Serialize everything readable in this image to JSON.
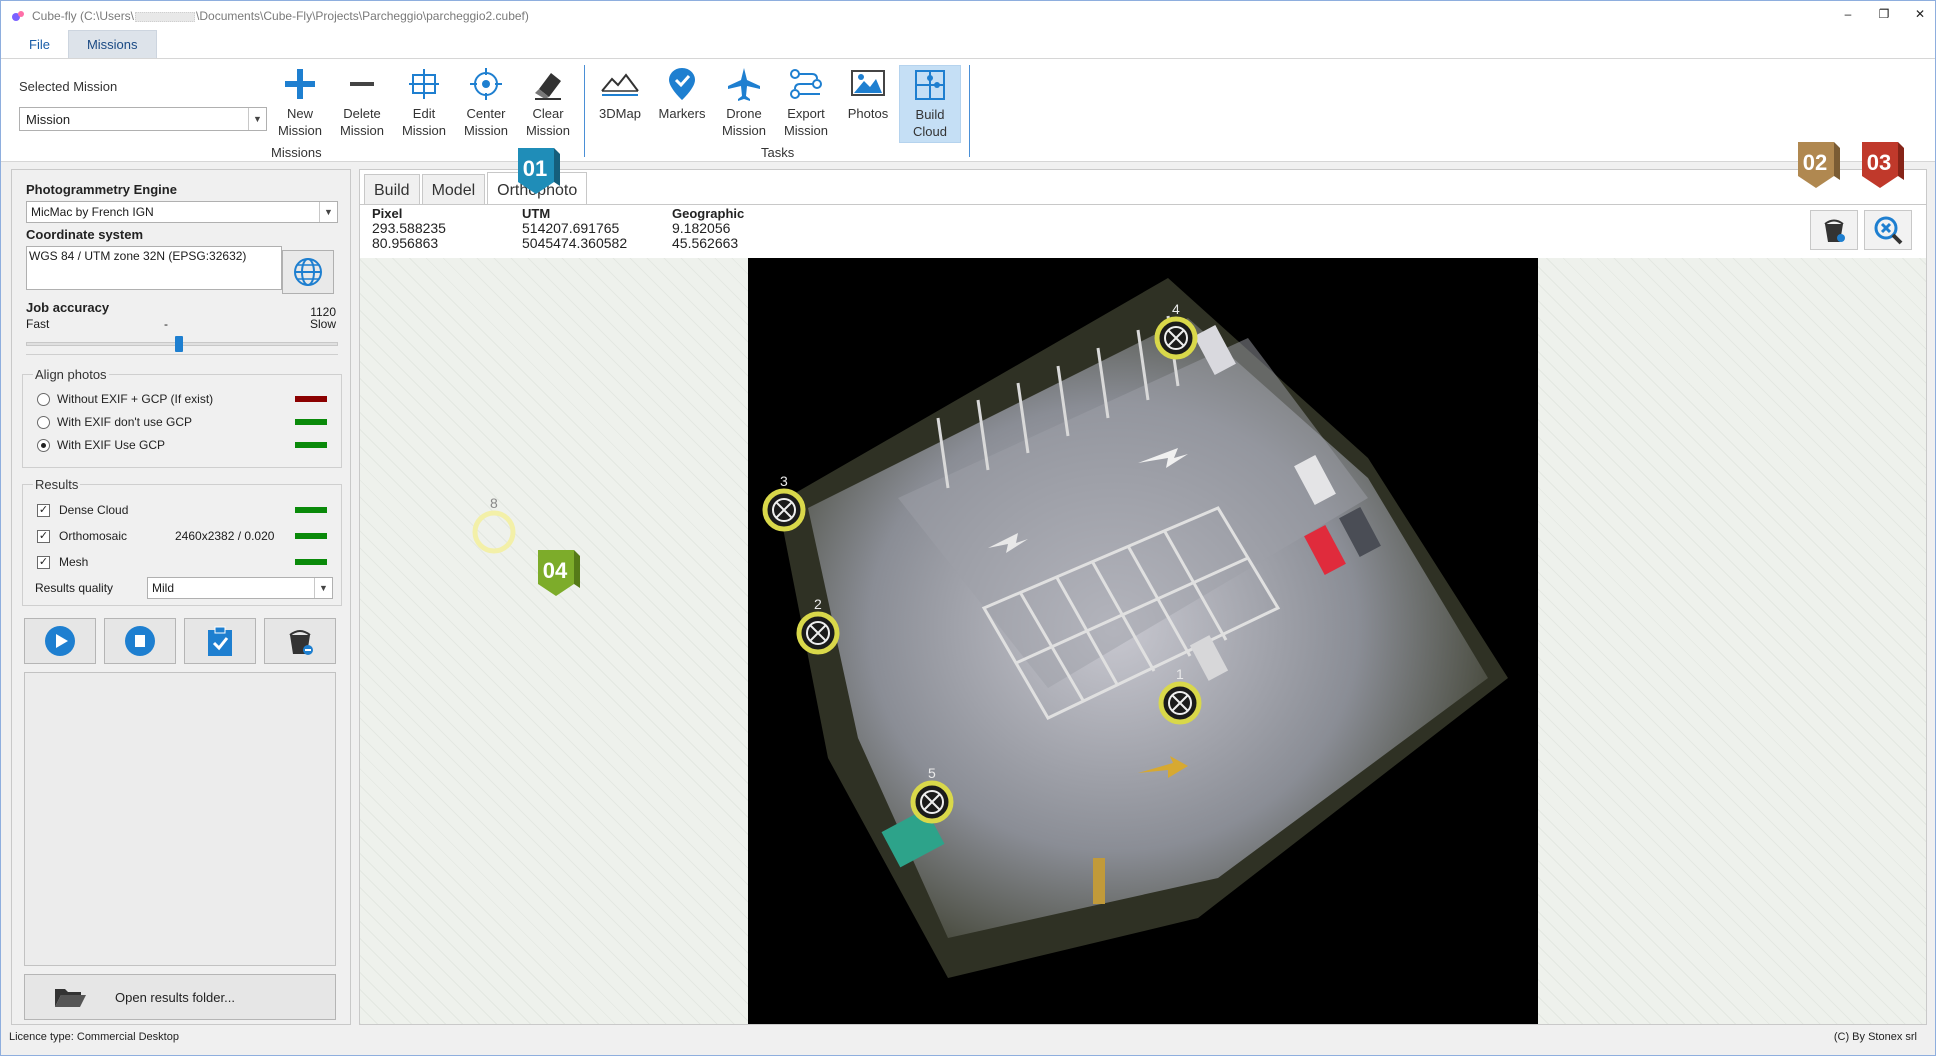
{
  "window": {
    "title_prefix": "Cube-fly (C:\\Users\\",
    "title_suffix": "\\Documents\\Cube-Fly\\Projects\\Parcheggio\\parcheggio2.cubef)",
    "controls": [
      "–",
      "❐",
      "✕"
    ]
  },
  "menu": {
    "tabs": [
      "File",
      "Missions"
    ],
    "active": "Missions"
  },
  "ribbon": {
    "selected_mission_label": "Selected Mission",
    "selected_mission_value": "Mission",
    "missions_group": "Missions",
    "tasks_group": "Tasks",
    "buttons": {
      "new_mission": "New Mission",
      "delete_mission": "Delete Mission",
      "edit_mission": "Edit Mission",
      "center_mission": "Center Mission",
      "clear_mission": "Clear Mission",
      "map3d": "3DMap",
      "markers": "Markers",
      "drone_mission": "Drone Mission",
      "export_mission": "Export Mission",
      "photos": "Photos",
      "build_cloud": "Build Cloud"
    }
  },
  "left": {
    "engine_label": "Photogrammetry Engine",
    "engine_value": "MicMac by French IGN",
    "coord_label": "Coordinate system",
    "coord_value": "WGS 84 / UTM zone 32N (EPSG:32632)",
    "accuracy_label": "Job accuracy",
    "accuracy_fast": "Fast",
    "accuracy_slow": "Slow",
    "accuracy_value": "1120",
    "accuracy_mid": "-",
    "accuracy_fraction": 0.49,
    "align_label": "Align photos",
    "align_options": [
      {
        "label": "Without EXIF + GCP (If exist)",
        "selected": false,
        "status": "#8b0000"
      },
      {
        "label": "With EXIF don't use GCP",
        "selected": false,
        "status": "#0a8a0a"
      },
      {
        "label": "With EXIF Use GCP",
        "selected": true,
        "status": "#0a8a0a"
      }
    ],
    "results_label": "Results",
    "results": [
      {
        "label": "Dense Cloud",
        "checked": true,
        "extra": "",
        "status": "#0a8a0a"
      },
      {
        "label": "Orthomosaic",
        "checked": true,
        "extra": "2460x2382 / 0.020",
        "status": "#0a8a0a"
      },
      {
        "label": "Mesh",
        "checked": true,
        "extra": "",
        "status": "#0a8a0a"
      }
    ],
    "quality_label": "Results quality",
    "quality_value": "Mild",
    "open_folder": "Open results folder..."
  },
  "main": {
    "tabs": [
      "Build",
      "Model",
      "Orthophoto"
    ],
    "active_tab": "Orthophoto",
    "coords": {
      "pixel_label": "Pixel",
      "pixel_x": "293.588235",
      "pixel_y": "80.956863",
      "utm_label": "UTM",
      "utm_x": "514207.691765",
      "utm_y": "5045474.360582",
      "geo_label": "Geographic",
      "geo_x": "9.182056",
      "geo_y": "45.562663"
    },
    "badges": [
      "01",
      "02",
      "03",
      "04"
    ],
    "markers": [
      "1",
      "2",
      "3",
      "4",
      "5",
      "8"
    ]
  },
  "status": {
    "licence": "Licence type: Commercial Desktop",
    "copyright": "(C) By Stonex srl"
  },
  "colors": {
    "accent": "#1e7fd0",
    "ok": "#0a8a0a",
    "error": "#8b0000",
    "badge01": "#1f8db8",
    "badge02": "#b08850",
    "badge03": "#c0392b",
    "badge04": "#7dac2a"
  }
}
